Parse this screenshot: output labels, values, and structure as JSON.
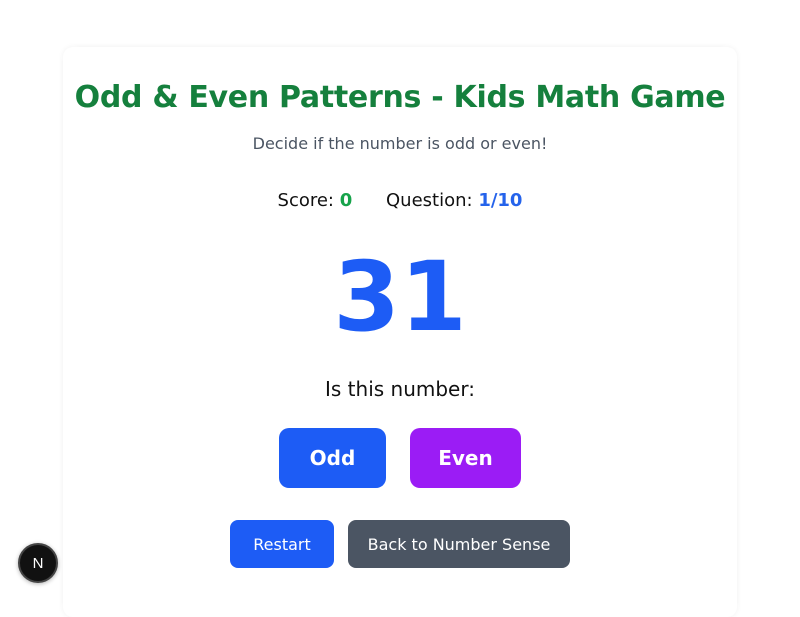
{
  "game": {
    "title": "Odd & Even Patterns - Kids Math Game",
    "subtitle": "Decide if the number is odd or even!",
    "score_label": "Score:",
    "score_value": "0",
    "question_label": "Question:",
    "question_value": "1/10",
    "current_number": "31",
    "prompt": "Is this number:",
    "odd_label": "Odd",
    "even_label": "Even",
    "restart_label": "Restart",
    "back_label": "Back to Number Sense"
  },
  "dev_badge": {
    "letter": "N",
    "icon": "nextjs-icon"
  },
  "colors": {
    "title": "#15803d",
    "score": "#16a34a",
    "question": "#2563eb",
    "number": "#1d5cf5",
    "odd_button": "#1d5cf5",
    "even_button": "#9b1cf5",
    "restart_button": "#1d5cf5",
    "back_button": "#4b5563"
  }
}
